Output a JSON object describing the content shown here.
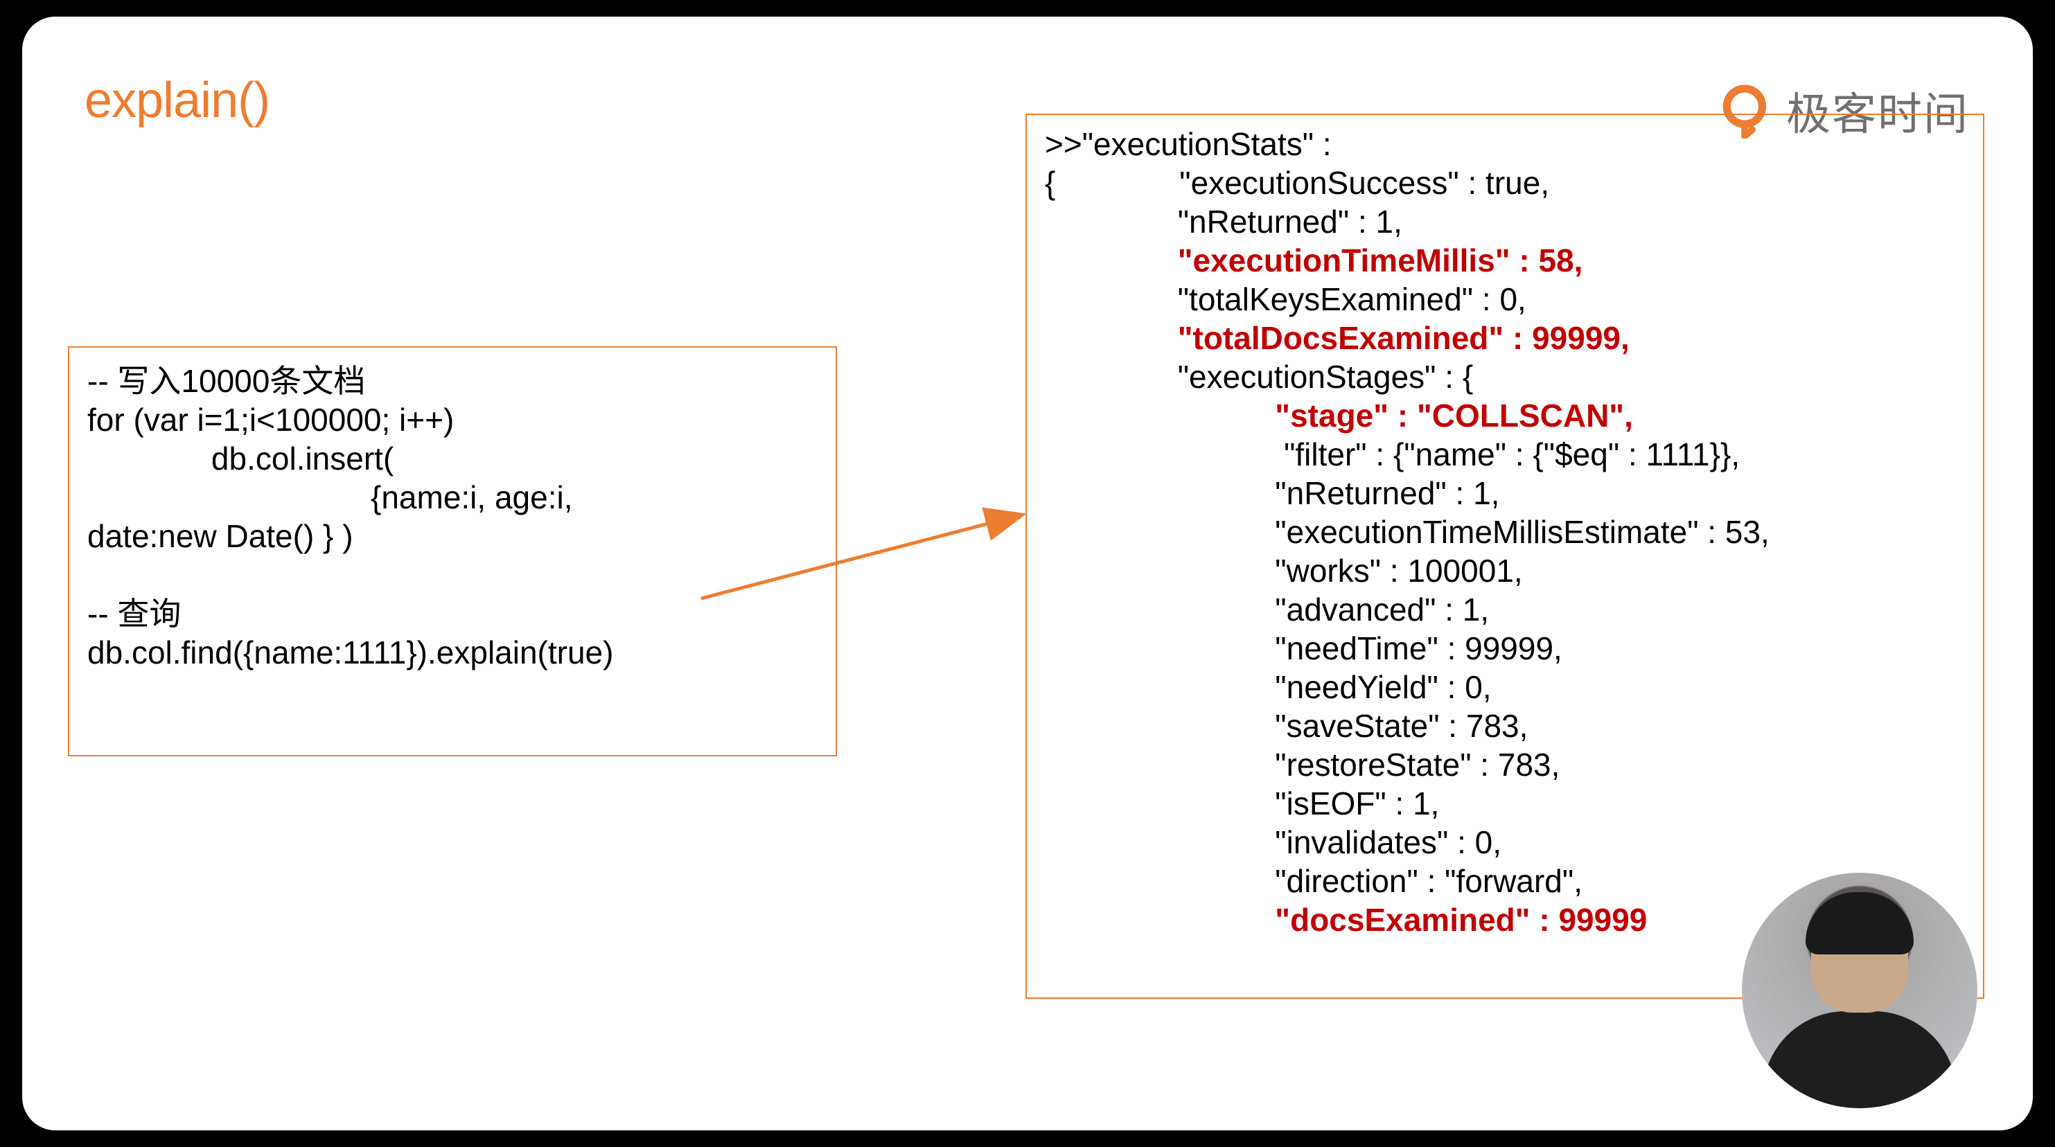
{
  "title": "explain()",
  "logo_text": "极客时间",
  "left_code": {
    "c1": "-- 写入10000条文档",
    "c2": "for (var i=1;i<100000; i++)",
    "c3": "              db.col.insert(",
    "c4": "                                {name:i, age:i,",
    "c5": "date:new Date() } )",
    "c6": "",
    "c7": "-- 查询",
    "c8": "db.col.find({name:1111}).explain(true)"
  },
  "right_code": {
    "r1": ">>\"executionStats\" :",
    "r2": "{              \"executionSuccess\" : true,",
    "r3": "               \"nReturned\" : 1,",
    "r4h": "               \"executionTimeMillis\" : 58,",
    "r5": "               \"totalKeysExamined\" : 0,",
    "r6h": "               \"totalDocsExamined\" : 99999,",
    "r7": "               \"executionStages\" : {",
    "r8h": "                          \"stage\" : \"COLLSCAN\",",
    "r9": "                           \"filter\" : {\"name\" : {\"$eq\" : 1111}},",
    "r10": "                          \"nReturned\" : 1,",
    "r11": "                          \"executionTimeMillisEstimate\" : 53,",
    "r12": "                          \"works\" : 100001,",
    "r13": "                          \"advanced\" : 1,",
    "r14": "                          \"needTime\" : 99999,",
    "r15": "                          \"needYield\" : 0,",
    "r16": "                          \"saveState\" : 783,",
    "r17": "                          \"restoreState\" : 783,",
    "r18": "                          \"isEOF\" : 1,",
    "r19": "                          \"invalidates\" : 0,",
    "r20": "                          \"direction\" : \"forward\",",
    "r21h": "                          \"docsExamined\" : 99999"
  },
  "colors": {
    "accent": "#ed7d31",
    "highlight": "#c00000"
  }
}
